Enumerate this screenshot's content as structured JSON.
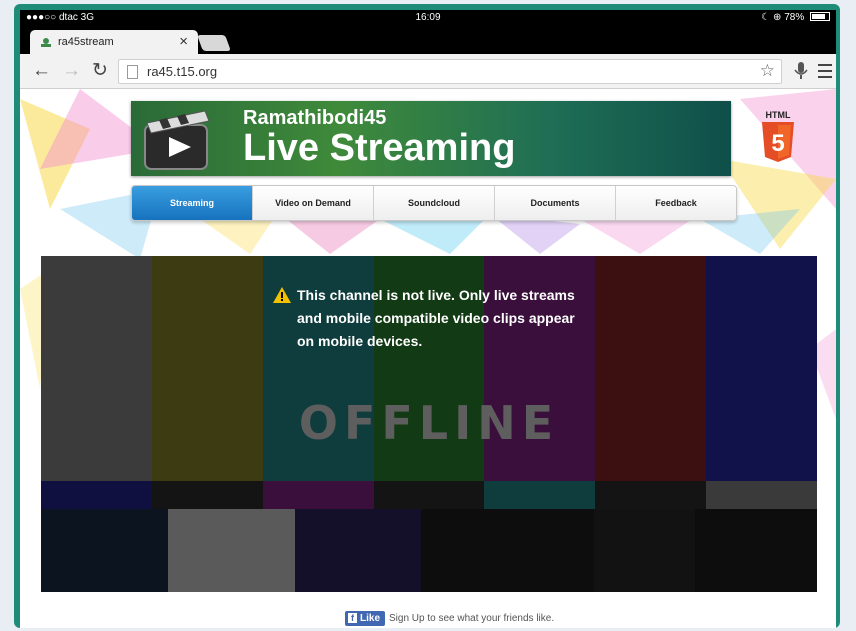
{
  "status_bar": {
    "carrier": "●●●○○ dtac",
    "network": "3G",
    "time": "16:09",
    "battery": "78%"
  },
  "browser": {
    "tab_title": "ra45stream",
    "tab_close": "×",
    "url": "ra45.t15.org"
  },
  "banner": {
    "subtitle": "Ramathibodi45",
    "title": "Live Streaming",
    "html5_label": "HTML",
    "html5_number": "5",
    "colors": {
      "banner": "#2f7a3c",
      "accent": "#1a80cc"
    }
  },
  "nav": {
    "items": [
      {
        "label": "Streaming",
        "active": true
      },
      {
        "label": "Video on Demand",
        "active": false
      },
      {
        "label": "Soundcloud",
        "active": false
      },
      {
        "label": "Documents",
        "active": false
      },
      {
        "label": "Feedback",
        "active": false
      }
    ]
  },
  "player": {
    "offline_text": "OFFLINE",
    "message": "This channel is not live. Only live streams and mobile compatible video clips appear on mobile devices."
  },
  "facebook": {
    "like_label": "Like",
    "signup_text": "Sign Up to see what your friends like."
  }
}
